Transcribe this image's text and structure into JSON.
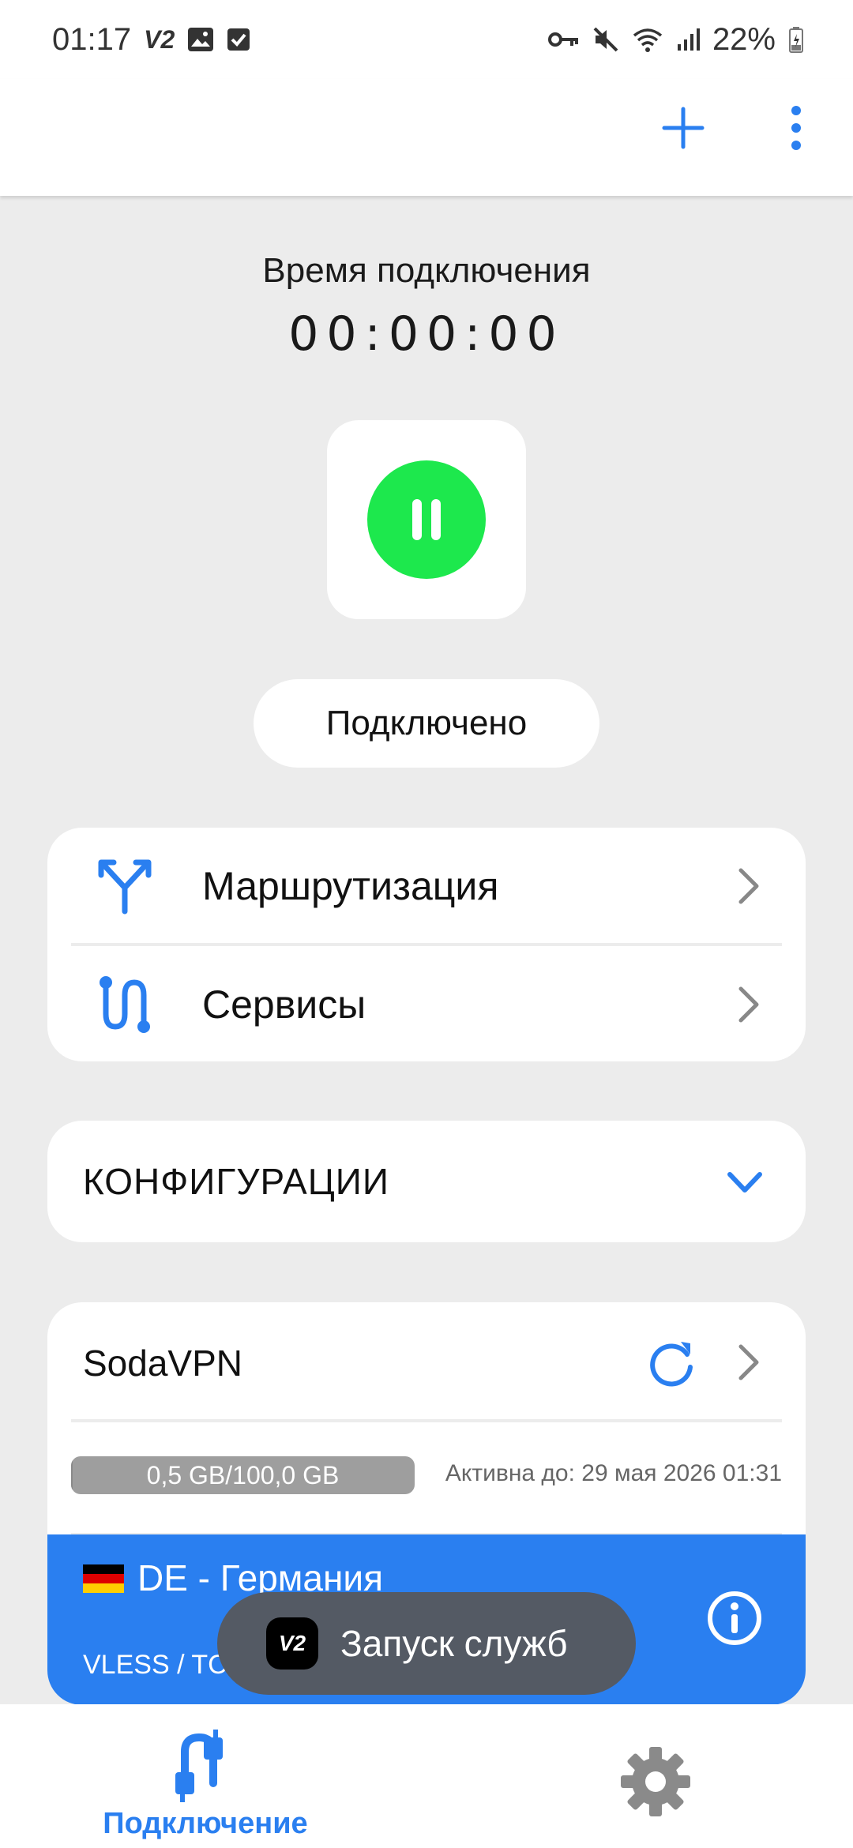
{
  "status_bar": {
    "time": "01:17",
    "app_badge": "V2",
    "battery": "22%",
    "icons": [
      "v2-icon",
      "image-icon",
      "checkbox-icon",
      "vpn-key-icon",
      "mute-icon",
      "wifi-icon",
      "signal-icon",
      "battery-icon"
    ]
  },
  "connection": {
    "time_label": "Время подключения",
    "time_value": "00:00:00",
    "status": "Подключено"
  },
  "menu": {
    "routing_label": "Маршрутизация",
    "services_label": "Сервисы"
  },
  "configs": {
    "title": "КОНФИГУРАЦИИ"
  },
  "subscription": {
    "name": "SodaVPN",
    "usage_text": "0,5 GB/100,0 GB",
    "usage_fraction": 0.005,
    "active_until": "Активна до: 29 мая 2026 01:31",
    "server": {
      "name": "DE - Германия",
      "protocol": "VLESS / TCP"
    }
  },
  "toast": {
    "icon_text": "V2",
    "text": "Запуск служб"
  },
  "bottom_nav": {
    "connection_label": "Подключение"
  },
  "colors": {
    "accent": "#2a7ff0",
    "connected_green": "#1de84d",
    "background": "#ececec"
  }
}
